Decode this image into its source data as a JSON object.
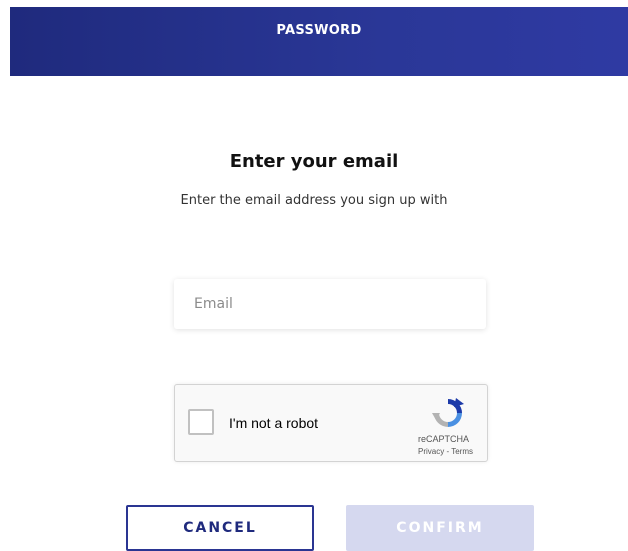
{
  "header": {
    "title": "PASSWORD"
  },
  "main": {
    "title": "Enter your email",
    "subtitle": "Enter the email address you sign up with"
  },
  "email": {
    "placeholder": "Email",
    "value": ""
  },
  "recaptcha": {
    "label": "I'm not a robot",
    "brand": "reCAPTCHA",
    "privacy": "Privacy",
    "separator": " - ",
    "terms": "Terms",
    "checked": false
  },
  "buttons": {
    "cancel": "CANCEL",
    "confirm": "CONFIRM"
  },
  "colors": {
    "header_bg": "#2a3592",
    "confirm_disabled": "#d5d8ef",
    "cancel_border": "#2a3592"
  }
}
